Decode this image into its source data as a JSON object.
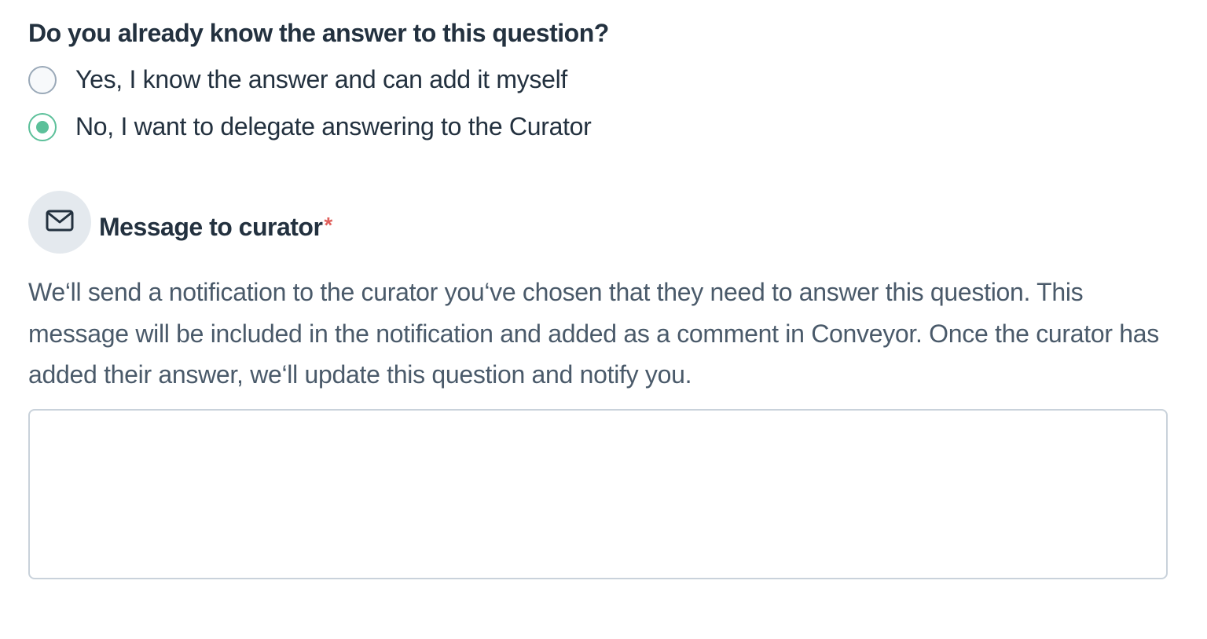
{
  "question": {
    "title": "Do you already know the answer to this question?",
    "options": [
      {
        "label": "Yes, I know the answer and can add it myself",
        "selected": false
      },
      {
        "label": "No, I want to delegate answering to the Curator",
        "selected": true
      }
    ]
  },
  "message": {
    "icon": "mail-icon",
    "title": "Message to curator",
    "required_marker": "*",
    "description": "We‘ll send a notification to the curator you‘ve chosen that they need to answer this question. This message will be included in the notification and added as a comment in Conveyor. Once the curator has added their answer, we‘ll update this question and notify you.",
    "input_value": ""
  },
  "colors": {
    "accent": "#5cc09a",
    "required": "#e0605c",
    "text": "#23313f",
    "muted_text": "#4a5a6a"
  }
}
